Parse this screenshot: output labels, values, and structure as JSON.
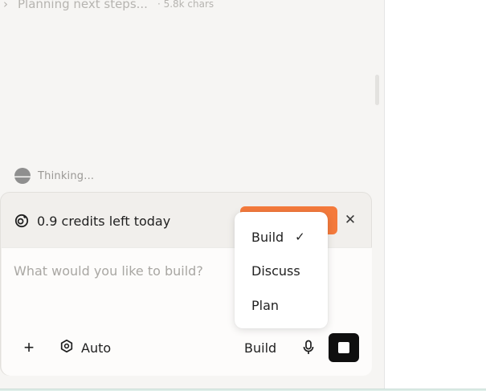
{
  "history": {
    "planning_text": "Planning next steps...",
    "planning_meta": "· 5.8k chars"
  },
  "status": {
    "thinking_label": "Thinking..."
  },
  "credits": {
    "text": "0.9 credits left today"
  },
  "composer": {
    "placeholder": "What would you like to build?",
    "model_label": "Auto",
    "mode_label": "Build"
  },
  "mode_menu": {
    "items": [
      {
        "label": "Build",
        "selected": true
      },
      {
        "label": "Discuss",
        "selected": false
      },
      {
        "label": "Plan",
        "selected": false
      }
    ],
    "check_glyph": "✓"
  },
  "icons": {
    "expand": "chevron-right-icon",
    "thinking": "thinking-sphere-icon",
    "credits": "credits-coin-icon",
    "close": "close-icon",
    "add": "plus-icon",
    "model": "hexagon-icon",
    "mic": "microphone-icon",
    "stop": "stop-icon"
  },
  "colors": {
    "accent": "#f47a3c",
    "stop_button": "#0f0f0f",
    "background": "#f6f5f3"
  }
}
